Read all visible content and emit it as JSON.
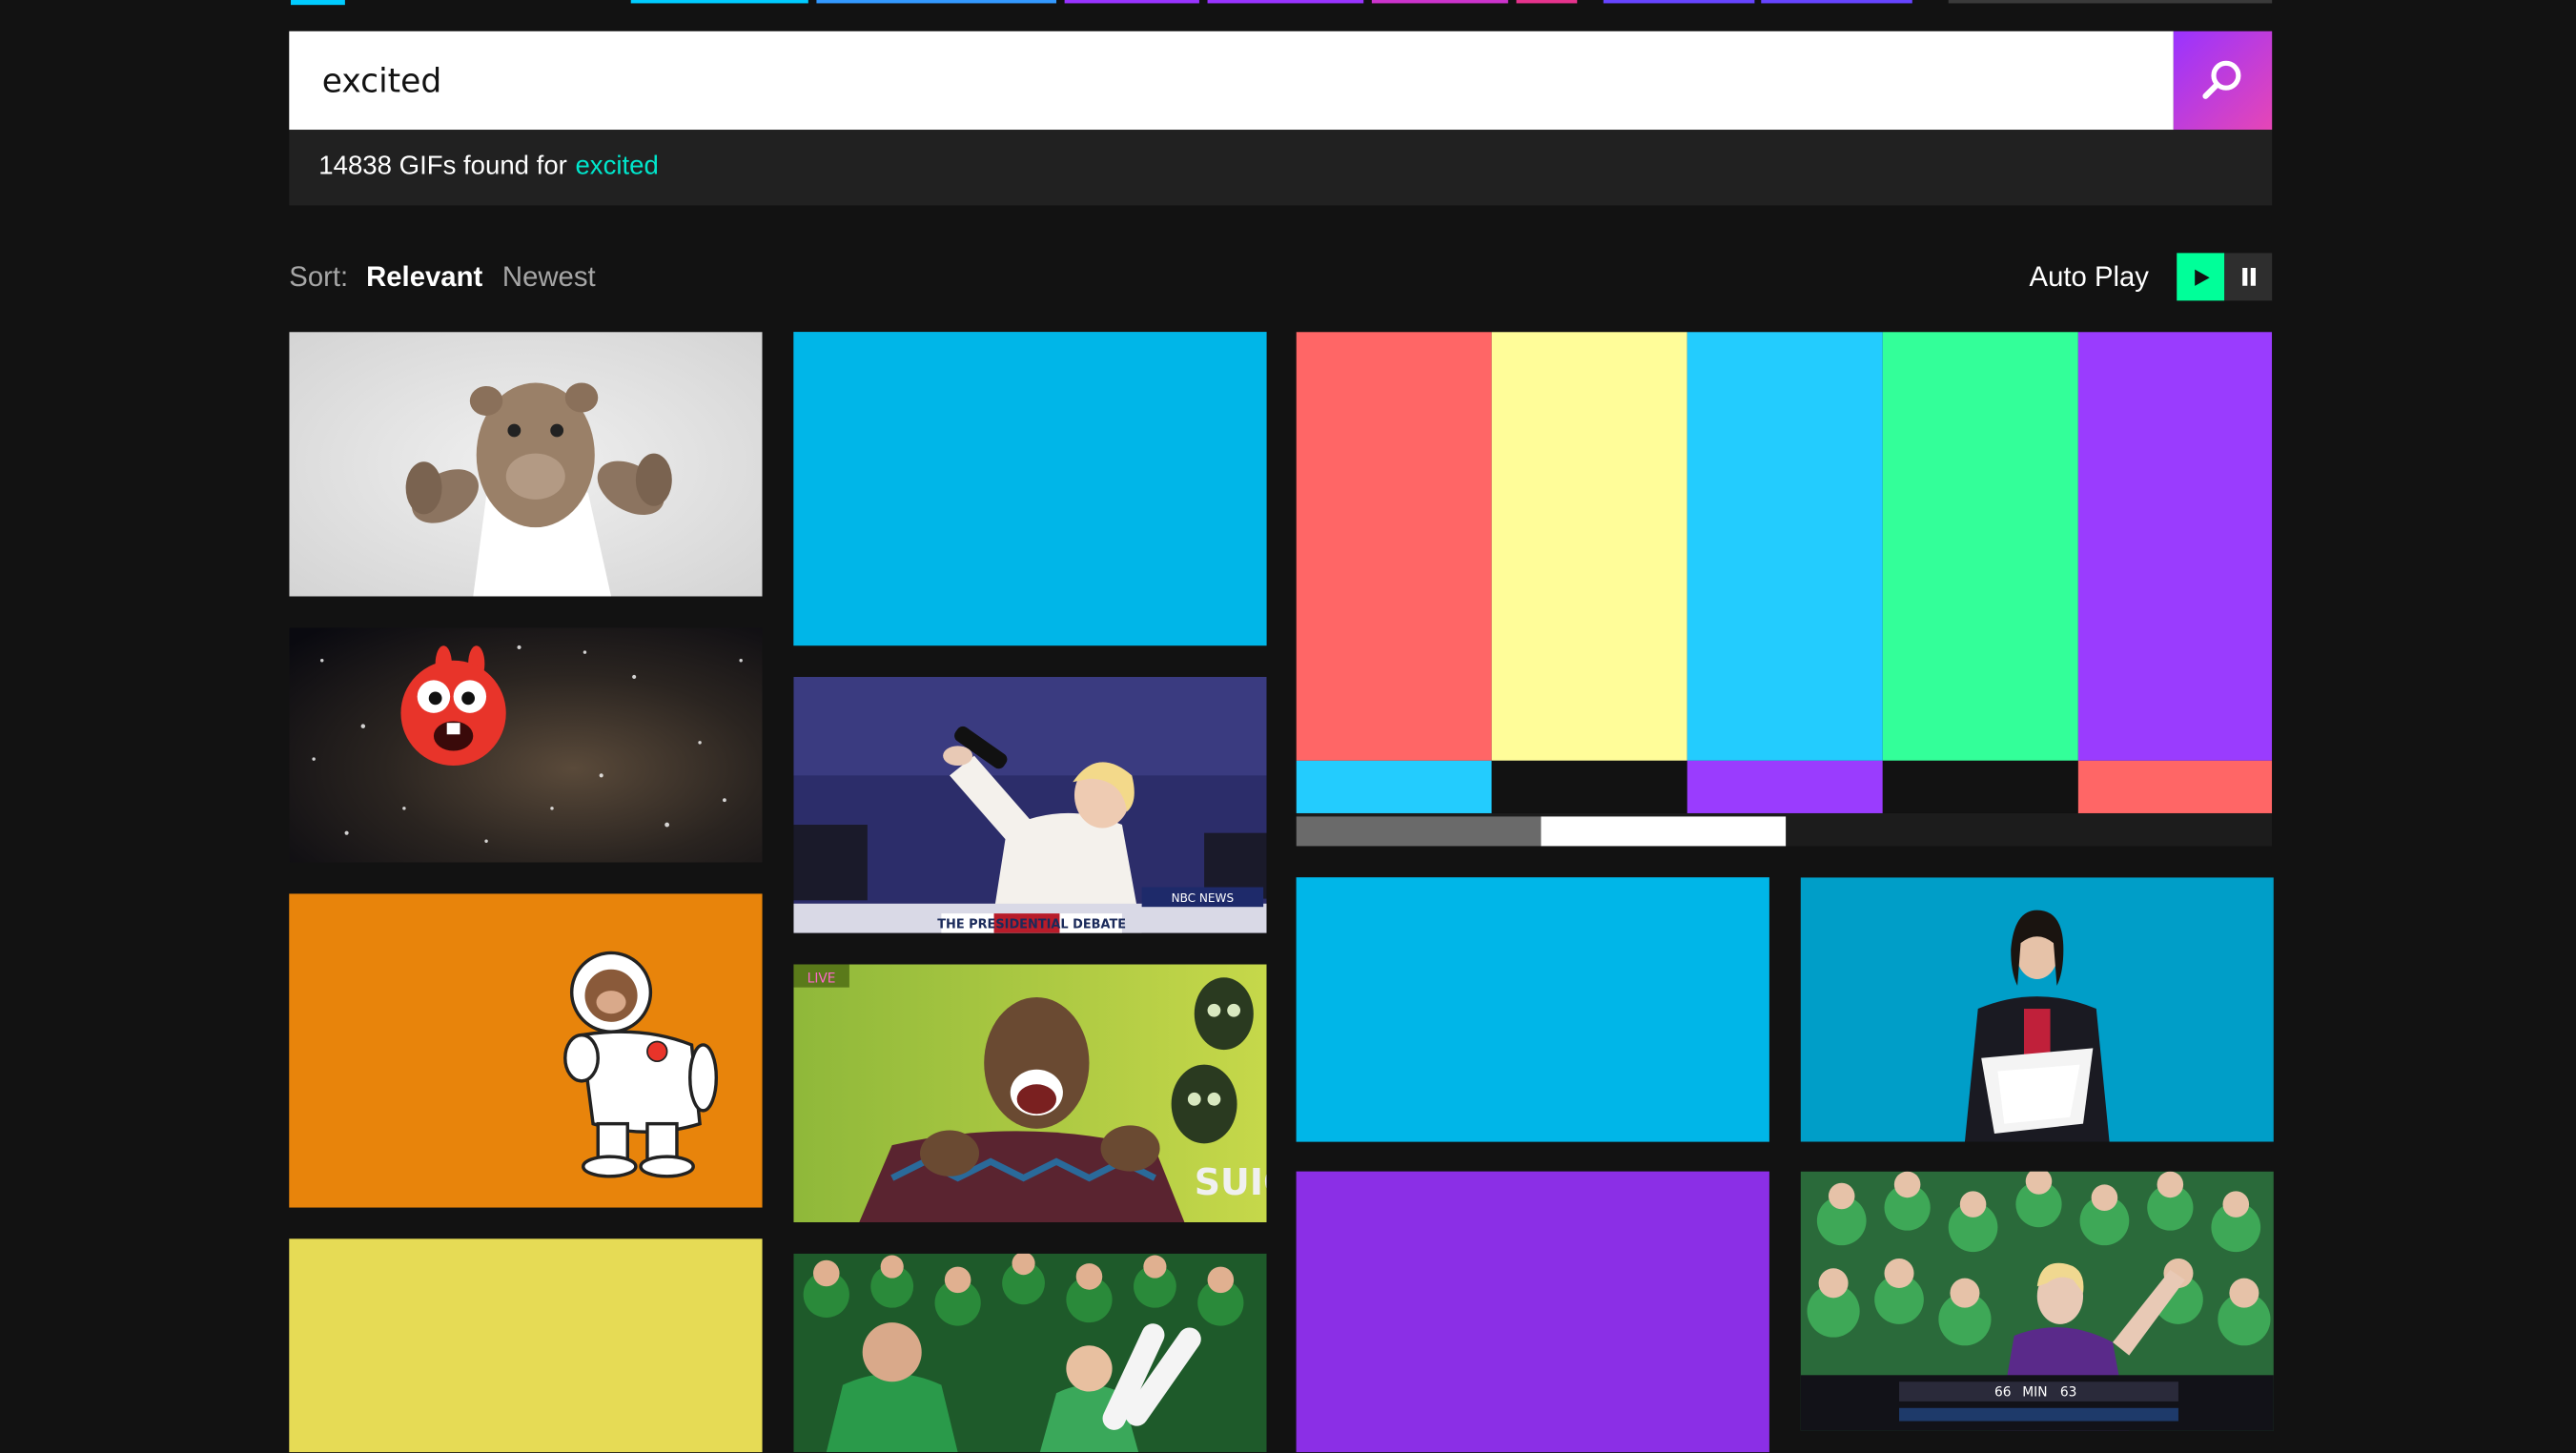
{
  "search": {
    "value": "excited",
    "button_icon": "search-icon"
  },
  "results": {
    "count_text": "14838 GIFs found for",
    "term": "excited"
  },
  "sort": {
    "label": "Sort:",
    "options": [
      "Relevant",
      "Newest"
    ],
    "selected": "Relevant"
  },
  "autoplay": {
    "label": "Auto Play",
    "play_icon": "play-icon",
    "pause_icon": "pause-icon"
  },
  "tiles": {
    "spacetrain_badge": "LIVE",
    "debate_banner": "THE PRESIDENTIAL DEBATE",
    "debate_network": "NBC NEWS",
    "fans_scoreboard": [
      "66",
      "MIN",
      "63"
    ],
    "suicide_text": "SUIC"
  },
  "colors": {
    "accent_green": "#00ff99",
    "accent_teal": "#00e6cc",
    "accent_purple": "#9933ff",
    "blue_tile": "#00b6e8",
    "purple_tile": "#8b2fe6",
    "orange_tile": "#e8840b",
    "yellow_tile": "#e6db55"
  }
}
